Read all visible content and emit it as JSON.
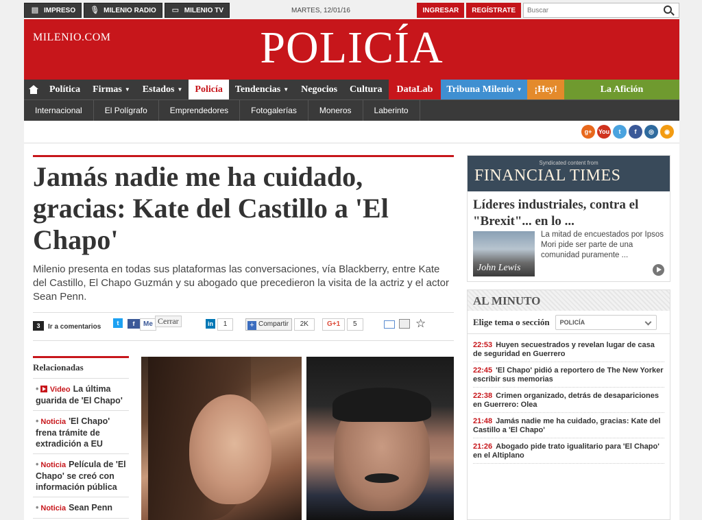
{
  "topbar": {
    "left": [
      {
        "label": "IMPRESO",
        "icon": "newspaper-icon",
        "glyph": "▤"
      },
      {
        "label": "MILENIO RADIO",
        "icon": "microphone-icon",
        "glyph": "🎙"
      },
      {
        "label": "MILENIO TV",
        "icon": "tv-icon",
        "glyph": "▭"
      }
    ],
    "date": "MARTES, 12/01/16",
    "login": "INGRESAR",
    "register": "REGÍSTRATE",
    "search_placeholder": "Buscar"
  },
  "masthead": {
    "site": "MILENIO.COM",
    "section": "POLICÍA"
  },
  "nav": {
    "items": [
      {
        "label": "Política"
      },
      {
        "label": "Firmas",
        "chev": true
      },
      {
        "label": "Estados",
        "chev": true
      },
      {
        "label": "Policía",
        "active": true
      },
      {
        "label": "Tendencias",
        "chev": true
      },
      {
        "label": "Negocios"
      },
      {
        "label": "Cultura"
      },
      {
        "label": "DataLab",
        "cls": "datalab"
      },
      {
        "label": "Tribuna Milenio",
        "chev": true,
        "cls": "tribuna"
      },
      {
        "label": "¡Hey!",
        "cls": "hey"
      },
      {
        "label": "La Afición",
        "cls": "aficion"
      }
    ],
    "sub": [
      "Internacional",
      "El Polígrafo",
      "Emprendedores",
      "Fotogalerías",
      "Moneros",
      "Laberinto"
    ]
  },
  "social": [
    "g+",
    "You",
    "t",
    "f",
    "◎",
    "◉"
  ],
  "article": {
    "headline": "Jamás nadie me ha cuidado, gracias: Kate del Castillo a 'El Chapo'",
    "dek": "Milenio presenta en todas sus plataformas las conversaciones, vía Blackberry, entre Kate del Castillo, El Chapo Guzmán y su abogado que precedieron la visita de la actriz y el actor Sean Penn.",
    "comments_count": "3",
    "comments_label": "Ir a comentarios",
    "fb_label": "Me",
    "close_label": "Cerrar",
    "in_count": "1",
    "share_label": "Compartir",
    "share_count": "2K",
    "gplus_label": "G+1",
    "gplus_count": "5"
  },
  "related": {
    "title": "Relacionadas",
    "items": [
      {
        "tag": "Video",
        "text": "La última guarida de 'El Chapo'",
        "video": true
      },
      {
        "tag": "Noticia",
        "text": "'El Chapo' frena trámite de extradición a EU"
      },
      {
        "tag": "Noticia",
        "text": "Película de 'El Chapo' se creó con información pública"
      },
      {
        "tag": "Noticia",
        "text": "Sean Penn"
      }
    ]
  },
  "ft": {
    "syndicated": "Syndicated content from",
    "name": "FINANCIAL TIMES",
    "headline": "Líderes industriales, contra el \"Brexit\"... en lo ...",
    "summary": "La mitad de encuestados por Ipsos Mori pide ser parte de una comunidad puramente ...",
    "image_caption": "John Lewis"
  },
  "al_minuto": {
    "title": "AL MINUTO",
    "select_label": "Elige tema o sección",
    "select_value": "POLICÍA",
    "items": [
      {
        "time": "22:53",
        "text": "Huyen secuestrados y revelan lugar de casa de seguridad en Guerrero"
      },
      {
        "time": "22:45",
        "text": "'El Chapo' pidió a reportero de The New Yorker escribir sus memorias"
      },
      {
        "time": "22:38",
        "text": "Crimen organizado, detrás de desapariciones en Guerrero: Olea"
      },
      {
        "time": "21:48",
        "text": "Jamás nadie me ha cuidado, gracias: Kate del Castillo a 'El Chapo'"
      },
      {
        "time": "21:26",
        "text": "Abogado pide trato igualitario para 'El Chapo' en el Altiplano"
      }
    ]
  }
}
